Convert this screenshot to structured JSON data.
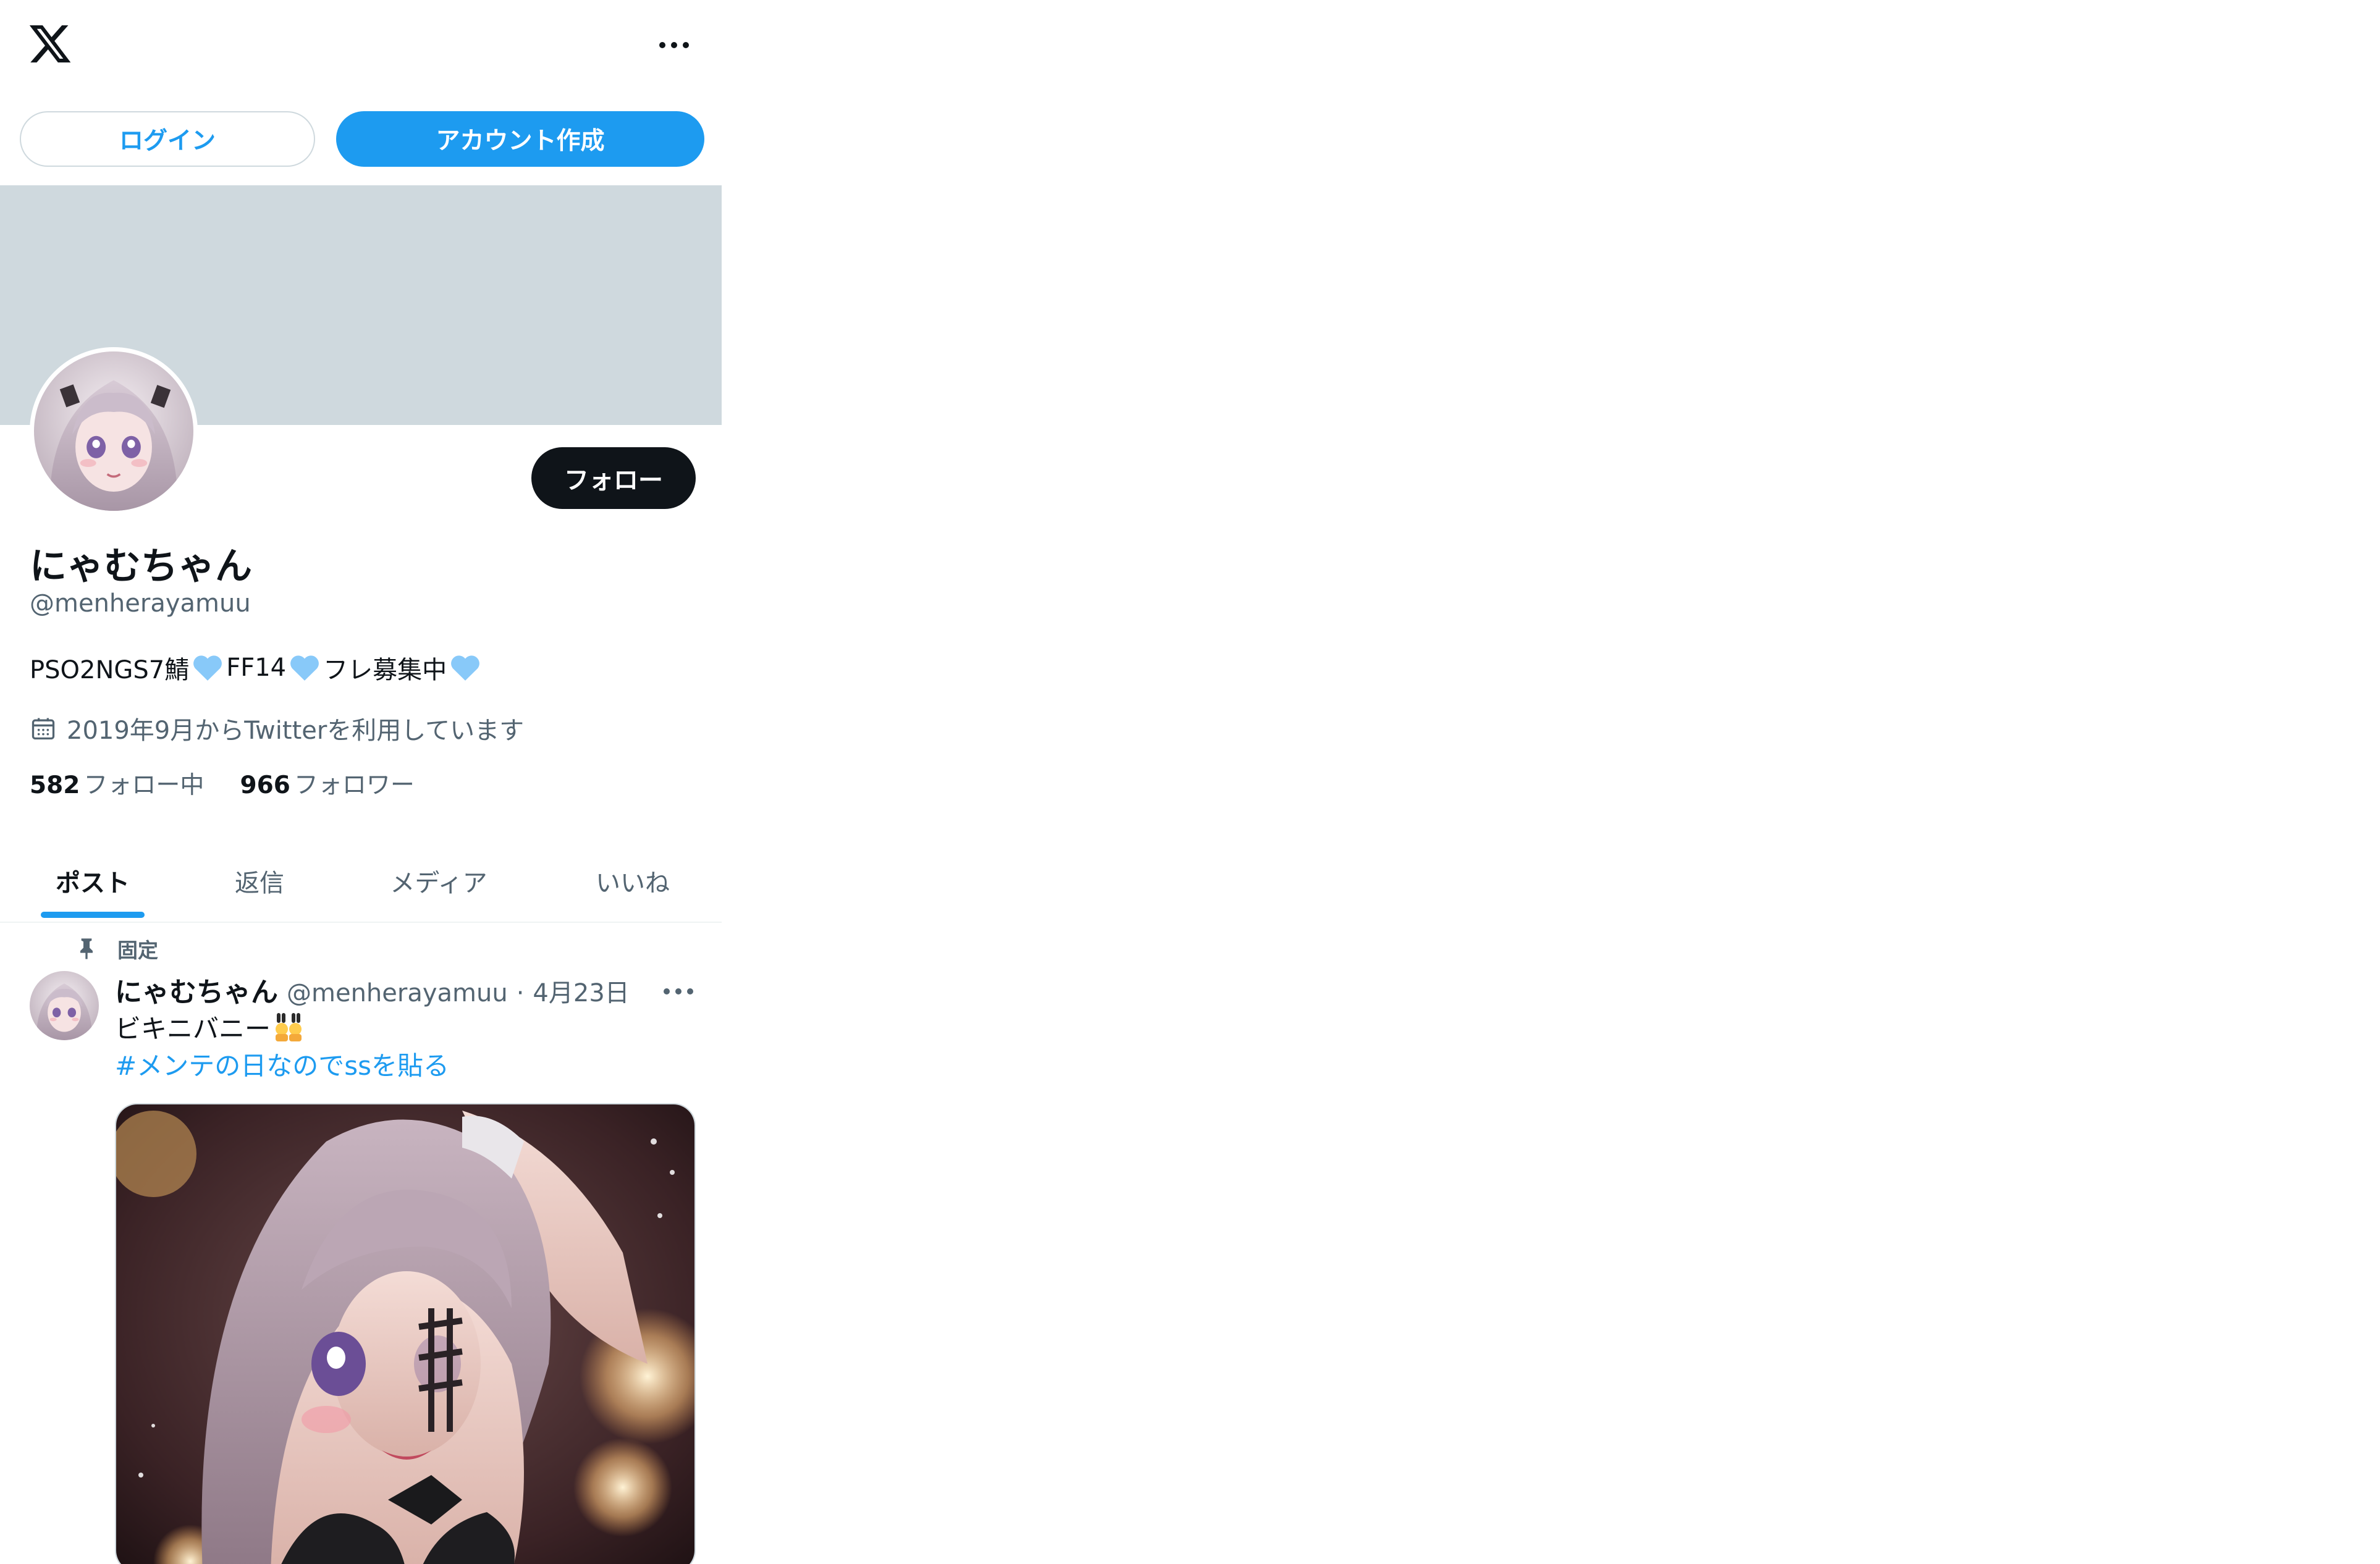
{
  "topbar": {
    "logo_icon": "x-logo-icon",
    "more_icon": "more-horizontal-icon"
  },
  "auth": {
    "login_label": "ログイン",
    "signup_label": "アカウント作成"
  },
  "profile": {
    "display_name": "にゃむちゃん",
    "handle": "@menherayamuu",
    "bio_parts": [
      "PSO2NGS7鯖",
      "FF14 ",
      "フレ募集中"
    ],
    "heart_icon": "light-blue-heart-emoji",
    "joined_icon": "calendar-icon",
    "joined_text": "2019年9月からTwitterを利用しています",
    "follow_label": "フォロー",
    "following_count": "582",
    "following_label": "フォロー中",
    "followers_count": "966",
    "followers_label": "フォロワー"
  },
  "tabs": [
    {
      "label": "ポスト",
      "active": true
    },
    {
      "label": "返信",
      "active": false
    },
    {
      "label": "メディア",
      "active": false
    },
    {
      "label": "いいね",
      "active": false
    }
  ],
  "pinned_tweet": {
    "pinned_label": "固定",
    "pin_icon": "pin-icon",
    "author_name": "にゃむちゃん",
    "author_handle": "@menherayamuu",
    "separator": "·",
    "date": "4月23日",
    "text": "ビキニバニー",
    "text_emoji": "two-women-with-bunny-ears-emoji",
    "hashtag": "#メンテの日なのでssを貼る",
    "more_icon": "more-horizontal-icon"
  },
  "colors": {
    "accent": "#1d9bf0",
    "banner": "#cfd9de",
    "text_primary": "#0f1419",
    "text_secondary": "#536471"
  }
}
